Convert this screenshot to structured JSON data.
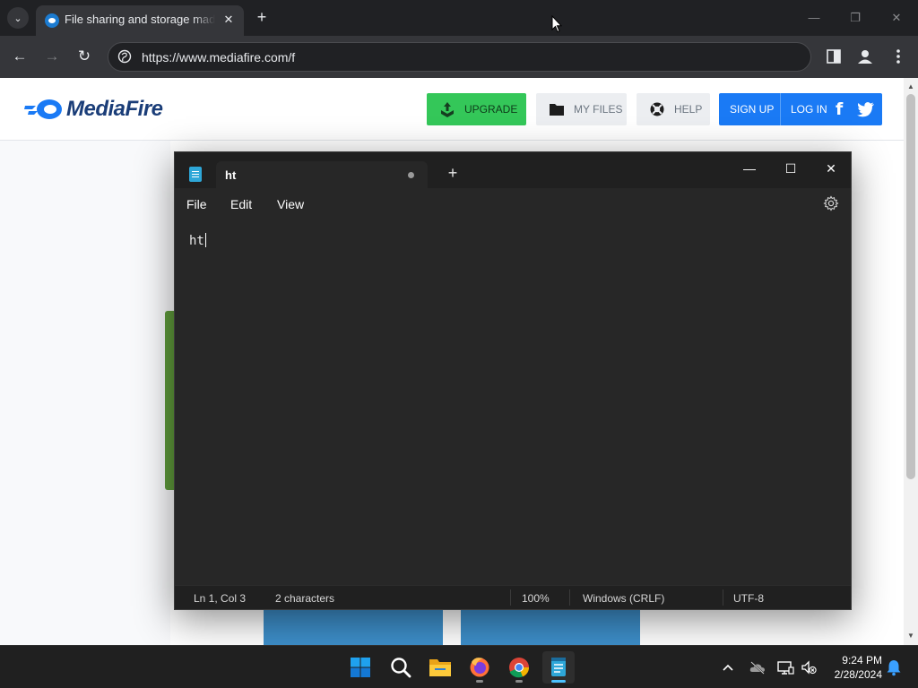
{
  "browser": {
    "tab_title": "File sharing and storage made simple",
    "tab_close": "✕",
    "new_tab": "+",
    "tab_list": "⌄",
    "url": "https://www.mediafire.com/f",
    "window_controls": {
      "minimize": "—",
      "maximize": "❐",
      "close": "✕"
    },
    "nav": {
      "back": "←",
      "forward": "→",
      "reload": "↻"
    }
  },
  "mediafire": {
    "logo_text": "MediaFire",
    "upgrade_label": "UPGRADE",
    "myfiles_label": "MY FILES",
    "help_label": "HELP",
    "signup_label": "SIGN UP",
    "login_label": "LOG IN",
    "facebook_glyph": "f",
    "colors": {
      "brand_blue": "#1a7af5",
      "upgrade_green": "#34c759",
      "logo_navy": "#1a3d78"
    }
  },
  "notepad": {
    "tab_title": "ht",
    "new_tab": "+",
    "window_controls": {
      "minimize": "—",
      "maximize": "☐",
      "close": "✕"
    },
    "menu": {
      "file": "File",
      "edit": "Edit",
      "view": "View"
    },
    "content": "ht",
    "status": {
      "position": "Ln 1, Col 3",
      "characters": "2 characters",
      "zoom": "100%",
      "line_ending": "Windows (CRLF)",
      "encoding": "UTF-8"
    },
    "unsaved": true
  },
  "taskbar": {
    "apps": [
      "start-icon",
      "search-icon",
      "file-explorer-icon",
      "firefox-icon",
      "chrome-icon",
      "notepad-icon"
    ],
    "tray_chevron": "^",
    "clock_time": "9:24 PM",
    "clock_date": "2/28/2024"
  }
}
